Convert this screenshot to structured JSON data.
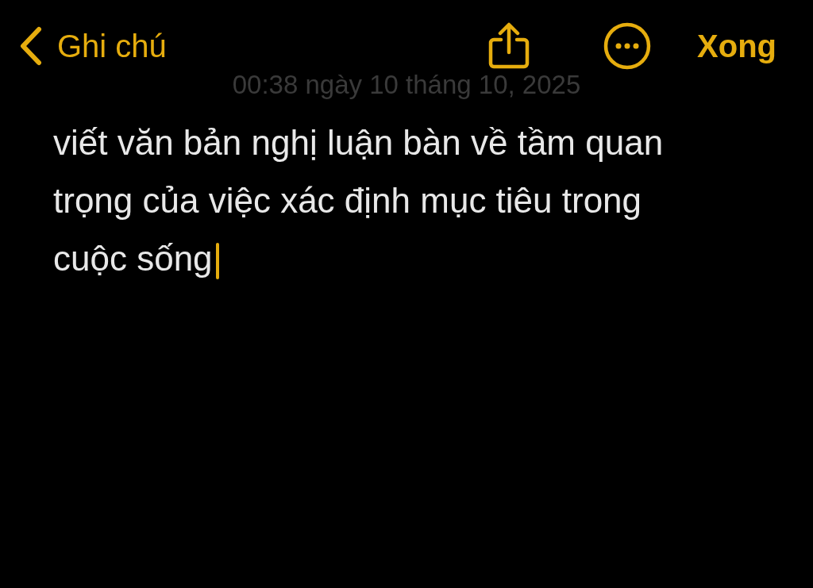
{
  "nav": {
    "back_label": "Ghi chú",
    "done_label": "Xong"
  },
  "note": {
    "timestamp": "00:38 ngày 10 tháng 10, 2025",
    "body": "viết văn bản nghị luận bàn về tầm quan trọng của việc xác định mục tiêu trong cuộc sống",
    "editing": true
  }
}
